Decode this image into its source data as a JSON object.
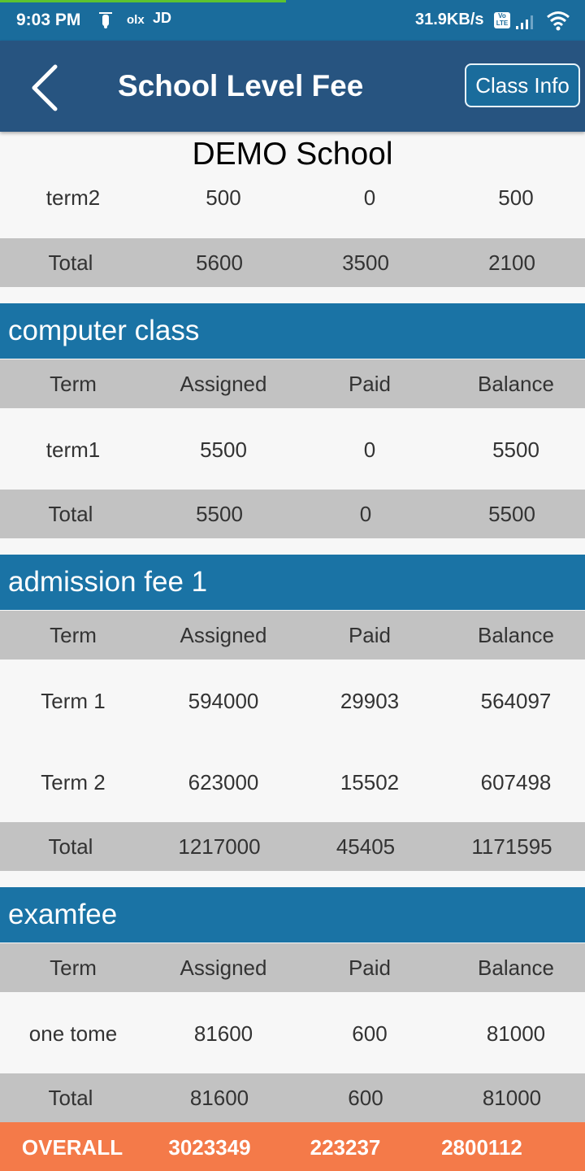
{
  "status_bar": {
    "time": "9:03 PM",
    "notification_icons": [
      "scooter-icon",
      "olx-icon",
      "JD"
    ],
    "network_speed": "31.9KB/s",
    "volte_label_top": "Vo",
    "volte_label_bottom": "LTE"
  },
  "app_bar": {
    "title": "School Level Fee",
    "class_info_label": "Class Info"
  },
  "school_name": "DEMO School",
  "sections": [
    {
      "title": "",
      "rows": [
        {
          "term": "term2",
          "assigned": "500",
          "paid": "0",
          "balance": "500"
        }
      ],
      "total": {
        "label": "Total",
        "assigned": "5600",
        "paid": "3500",
        "balance": "2100"
      }
    },
    {
      "title": "computer class",
      "header": {
        "term": "Term",
        "assigned": "Assigned",
        "paid": "Paid",
        "balance": "Balance"
      },
      "rows": [
        {
          "term": "term1",
          "assigned": "5500",
          "paid": "0",
          "balance": "5500"
        }
      ],
      "total": {
        "label": "Total",
        "assigned": "5500",
        "paid": "0",
        "balance": "5500"
      }
    },
    {
      "title": "admission fee 1",
      "header": {
        "term": "Term",
        "assigned": "Assigned",
        "paid": "Paid",
        "balance": "Balance"
      },
      "rows": [
        {
          "term": "Term 1",
          "assigned": "594000",
          "paid": "29903",
          "balance": "564097"
        },
        {
          "term": "Term 2",
          "assigned": "623000",
          "paid": "15502",
          "balance": "607498"
        }
      ],
      "total": {
        "label": "Total",
        "assigned": "1217000",
        "paid": "45405",
        "balance": "1171595"
      }
    },
    {
      "title": "examfee",
      "header": {
        "term": "Term",
        "assigned": "Assigned",
        "paid": "Paid",
        "balance": "Balance"
      },
      "rows": [
        {
          "term": "one tome",
          "assigned": "81600",
          "paid": "600",
          "balance": "81000"
        }
      ],
      "total": {
        "label": "Total",
        "assigned": "81600",
        "paid": "600",
        "balance": "81000"
      }
    }
  ],
  "overall": {
    "label": "OVERALL",
    "assigned": "3023349",
    "paid": "223237",
    "balance": "2800112"
  },
  "colors": {
    "status_bar": "#1a6c9c",
    "app_bar": "#275480",
    "section_header": "#1a73a5",
    "table_header": "#c2c2c2",
    "overall_bar": "#f47a49"
  }
}
